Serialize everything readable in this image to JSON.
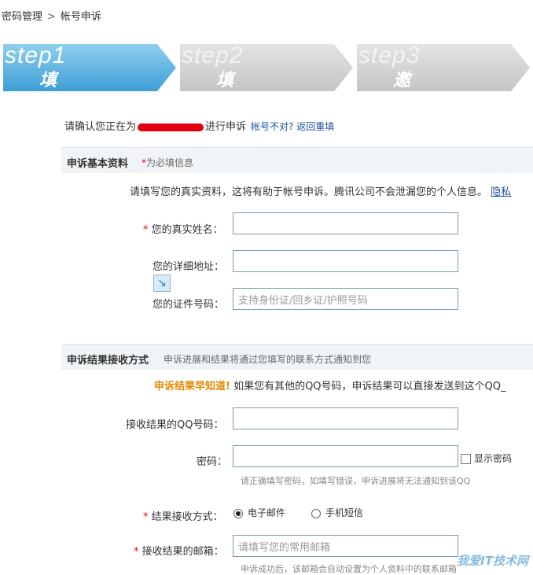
{
  "breadcrumb": {
    "parent": "密码管理",
    "separator": ">",
    "current": "帐号申诉"
  },
  "steps": [
    {
      "num": "step1",
      "title": "填写联系方式",
      "state": "active"
    },
    {
      "num": "step2",
      "title": "填写申诉资料",
      "state": "inactive"
    },
    {
      "num": "step3",
      "title": "邀请好友辅助",
      "state": "inactive"
    }
  ],
  "confirm": {
    "prefix": "请确认您正在为",
    "suffix": "进行申诉",
    "link": "帐号不对? 返回重填"
  },
  "basic": {
    "title": "申诉基本资料",
    "required_mark": "*",
    "required_note": "为必填信息",
    "intro": "请填写您的真实资料，这将有助于帐号申诉。腾讯公司不会泄漏您的个人信息。",
    "intro_link": "隐私",
    "name_label": "您的真实姓名：",
    "address_label": "您的详细地址：",
    "id_label": "您的证件号码：",
    "id_placeholder": "支持身份证/回乡证/护照号码"
  },
  "result": {
    "title": "申诉结果接收方式",
    "hint": "申诉进展和结果将通过您填写的联系方式通知到您",
    "early_title": "申诉结果早知道!",
    "early_text": "如果您有其他的QQ号码，申诉结果可以直接发送到这个QQ_",
    "qq_label": "接收结果的QQ号码：",
    "pwd_label": "密码：",
    "show_pwd": "显示密码",
    "pwd_note": "请正确填写密码，如填写错误，申诉进展将无法通知到该QQ",
    "method_label": "结果接收方式：",
    "method_email": "电子邮件",
    "method_sms": "手机短信",
    "email_label": "接收结果的邮箱：",
    "email_placeholder": "请填写您的常用邮箱",
    "email_note": "申诉成功后，该邮箱会自动设置为个人资料中的联系邮箱"
  },
  "watermark": "我爱IT技术网"
}
